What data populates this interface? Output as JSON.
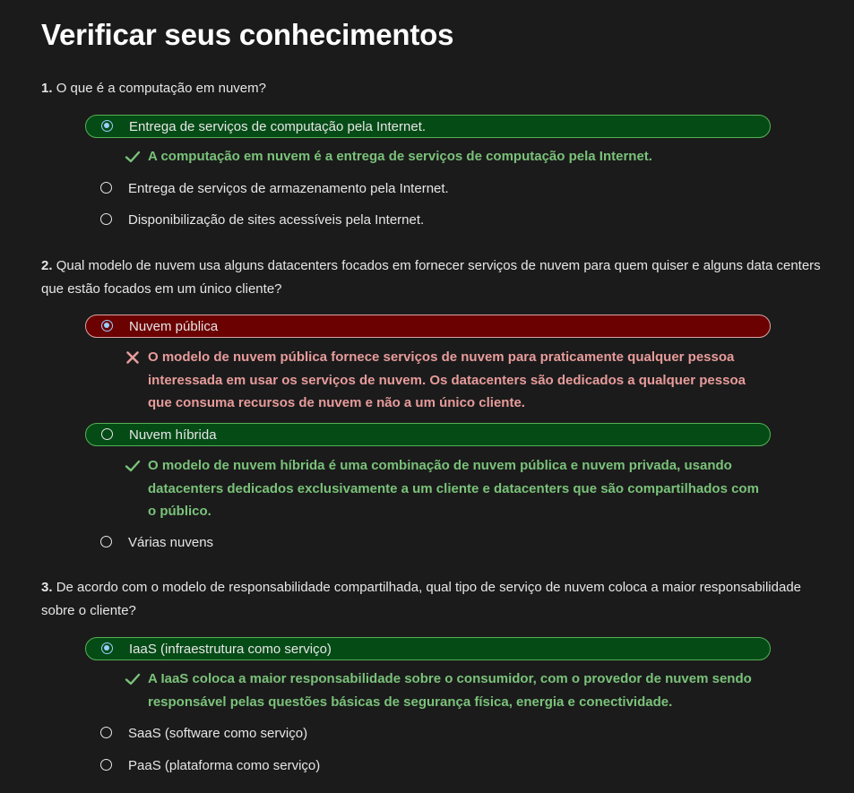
{
  "page": {
    "title": "Verificar seus conhecimentos"
  },
  "questions": [
    {
      "number": "1.",
      "text": "O que é a computação em nuvem?",
      "options": [
        {
          "label": "Entrega de serviços de computação pela Internet.",
          "selected": true,
          "status": "correct"
        },
        {
          "label": "Entrega de serviços de armazenamento pela Internet.",
          "selected": false,
          "status": "none"
        },
        {
          "label": "Disponibilização de sites acessíveis pela Internet.",
          "selected": false,
          "status": "none"
        }
      ],
      "feedback": [
        {
          "icon": "check-icon",
          "text": "A computação em nuvem é a entrega de serviços de computação pela Internet."
        }
      ]
    },
    {
      "number": "2.",
      "text": "Qual modelo de nuvem usa alguns datacenters focados em fornecer serviços de nuvem para quem quiser e alguns data centers que estão focados em um único cliente?",
      "options": [
        {
          "label": "Nuvem pública",
          "selected": true,
          "status": "wrong"
        },
        {
          "label": "Nuvem híbrida",
          "selected": false,
          "status": "correct"
        },
        {
          "label": "Várias nuvens",
          "selected": false,
          "status": "none"
        }
      ],
      "feedback": [
        {
          "icon": "cross-icon",
          "text": "O modelo de nuvem pública fornece serviços de nuvem para praticamente qualquer pessoa interessada em usar os serviços de nuvem. Os datacenters são dedicados a qualquer pessoa que consuma recursos de nuvem e não a um único cliente."
        },
        {
          "icon": "check-icon",
          "text": "O modelo de nuvem híbrida é uma combinação de nuvem pública e nuvem privada, usando datacenters dedicados exclusivamente a um cliente e datacenters que são compartilhados com o público."
        }
      ]
    },
    {
      "number": "3.",
      "text": "De acordo com o modelo de responsabilidade compartilhada, qual tipo de serviço de nuvem coloca a maior responsabilidade sobre o cliente?",
      "options": [
        {
          "label": "IaaS (infraestrutura como serviço)",
          "selected": true,
          "status": "correct"
        },
        {
          "label": "SaaS (software como serviço)",
          "selected": false,
          "status": "none"
        },
        {
          "label": "PaaS (plataforma como serviço)",
          "selected": false,
          "status": "none"
        }
      ],
      "feedback": [
        {
          "icon": "check-icon",
          "text": "A IaaS coloca a maior responsabilidade sobre o consumidor, com o provedor de nuvem sendo responsável pelas questões básicas de segurança física, energia e conectividade."
        }
      ]
    }
  ],
  "colors": {
    "background": "#1b1b1b",
    "correct_fill": "#054b16",
    "correct_border": "#54b054",
    "wrong_fill": "#6b0101",
    "wrong_border": "#d9a4a4",
    "correct_text": "#7ac27a",
    "wrong_text": "#e89b9b",
    "radio_selected": "#9ad0ff"
  }
}
